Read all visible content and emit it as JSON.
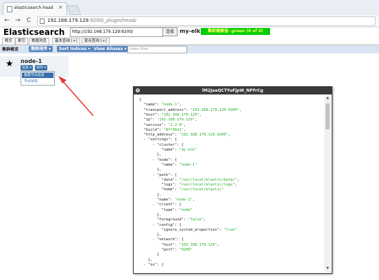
{
  "browser": {
    "tab_title": "elasticsearch-head",
    "tab_close": "×",
    "url_host": "192.168.179.129",
    "url_rest": ":9200/_plugin/head/",
    "back": "←",
    "forward": "→",
    "reload": "C"
  },
  "app": {
    "title": "Elasticsearch",
    "connect_url": "http://192.168.179.129:9200/",
    "connect_label": "连接",
    "cluster_name": "my-elk",
    "health": "集群健康值: green (0 of 0)"
  },
  "nav_tabs": [
    "概览",
    "索引",
    "数据浏览",
    "基本查询 [+]",
    "复合查询 [+]"
  ],
  "toolbar": {
    "label": "集群概览",
    "cluster_sort": "集群排序 ▾",
    "sort_indices": "Sort Indices ▾",
    "view_aliases": "View Aliases ▾",
    "filter_placeholder": "Index Filter"
  },
  "node": {
    "star": "★",
    "name": "node-1",
    "info_btn": "信息 ▾",
    "action_btn": "动作 ▾",
    "menu_items": [
      "集群节点信息",
      "节点状态"
    ]
  },
  "dialog": {
    "title": "lM2JaaQCTYuFjpW_NPFrCg",
    "close": "x",
    "json_lines": [
      {
        "t": "{"
      },
      {
        "t": "  \"name\": ",
        "v": "\"node-1\"",
        "s": ","
      },
      {
        "t": "  \"transport_address\": ",
        "v": "\"192.168.179.129:9300\"",
        "s": ","
      },
      {
        "t": "  \"host\": ",
        "v": "\"192.168.179.129\"",
        "s": ","
      },
      {
        "t": "  \"ip\": ",
        "v": "\"192.168.179.129\"",
        "s": ","
      },
      {
        "t": "  \"version\": ",
        "v": "\"2.2.0\"",
        "s": ","
      },
      {
        "t": "  \"build\": ",
        "v": "\"8ff36d1\"",
        "s": ","
      },
      {
        "t": "  \"http_address\": ",
        "v": "\"192.168.179.129:9200\"",
        "s": ","
      },
      {
        "t": "  - \"settings\": {"
      },
      {
        "t": "      - \"cluster\": {"
      },
      {
        "t": "          \"name\": ",
        "v": "\"my-elk\""
      },
      {
        "t": "        },"
      },
      {
        "t": "      - \"node\": {"
      },
      {
        "t": "          \"name\": ",
        "v": "\"node-1\""
      },
      {
        "t": "        },"
      },
      {
        "t": "      - \"path\": {"
      },
      {
        "t": "          \"data\": ",
        "v": "\"/usr/local/elastic/data/\"",
        "s": ","
      },
      {
        "t": "          \"logs\": ",
        "v": "\"/usr/local/elastic/logs\"",
        "s": ","
      },
      {
        "t": "          \"home\": ",
        "v": "\"/usr/local/elastic\""
      },
      {
        "t": "        },"
      },
      {
        "t": "        \"name\": ",
        "v": "\"node-1\"",
        "s": ","
      },
      {
        "t": "      - \"client\": {"
      },
      {
        "t": "          \"type\": ",
        "v": "\"node\""
      },
      {
        "t": "        },"
      },
      {
        "t": "        \"foreground\": ",
        "v": "\"false\"",
        "s": ","
      },
      {
        "t": "      - \"config\": {"
      },
      {
        "t": "          \"ignore_system_properties\": ",
        "v": "\"true\""
      },
      {
        "t": "        },"
      },
      {
        "t": "      - \"network\": {"
      },
      {
        "t": "          \"host\": ",
        "v": "\"192.168.179.129\"",
        "s": ","
      },
      {
        "t": "          \"port\": ",
        "v": "\"9200\""
      },
      {
        "t": "        }"
      },
      {
        "t": "    },"
      },
      {
        "t": "  - \"os\": {"
      }
    ]
  },
  "colors": {
    "health_green": "#00cc00",
    "json_value": "#22aa22",
    "accent_blue": "#5b88bf",
    "annotation_arrow": "#e53935"
  }
}
